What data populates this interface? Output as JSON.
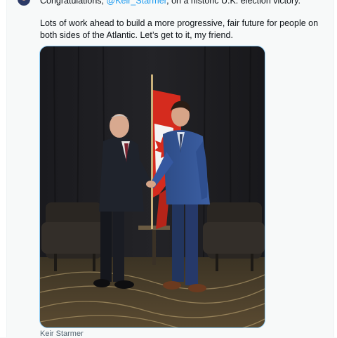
{
  "tweet": {
    "line1_prefix": "Congratulations, ",
    "mention": "@Keir_Starmer",
    "line1_suffix": ", on a historic U.K. election victory.",
    "paragraph2": "Lots of work ahead to build a more progressive, fair future for people on both sides of the Atlantic. Let’s get to it, my friend."
  },
  "media": {
    "alt": "Photo of two men shaking hands in front of a Canadian flag"
  },
  "caption": {
    "tagged_user": "Keir Starmer"
  },
  "colors": {
    "link": "#1d9bf0",
    "media_border": "#8ecdf7",
    "secondary_text": "#536471"
  }
}
